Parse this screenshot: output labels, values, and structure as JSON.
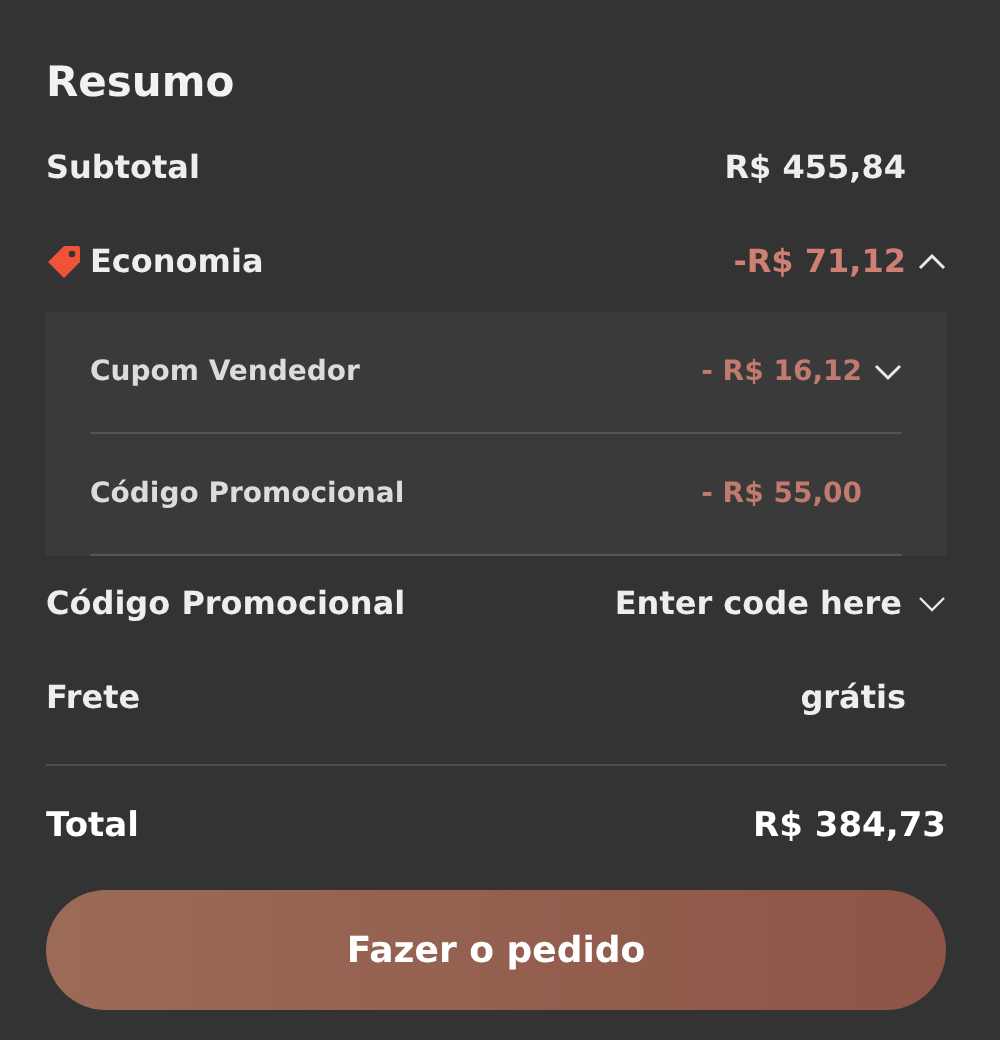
{
  "title": "Resumo",
  "subtotal": {
    "label": "Subtotal",
    "value": "R$ 455,84"
  },
  "savings": {
    "label": "Economia",
    "value": "-R$ 71,12",
    "expanded": true,
    "items": [
      {
        "label": "Cupom Vendedor",
        "value": "- R$ 16,12",
        "expanded": false
      },
      {
        "label": "Código Promocional",
        "value": "- R$ 55,00"
      }
    ]
  },
  "promo_code": {
    "label": "Código Promocional",
    "toggle_label": "Enter code here",
    "expanded": false
  },
  "shipping": {
    "label": "Frete",
    "value": "grátis"
  },
  "total": {
    "label": "Total",
    "value": "R$ 384,73"
  },
  "button": "Fazer o pedido"
}
